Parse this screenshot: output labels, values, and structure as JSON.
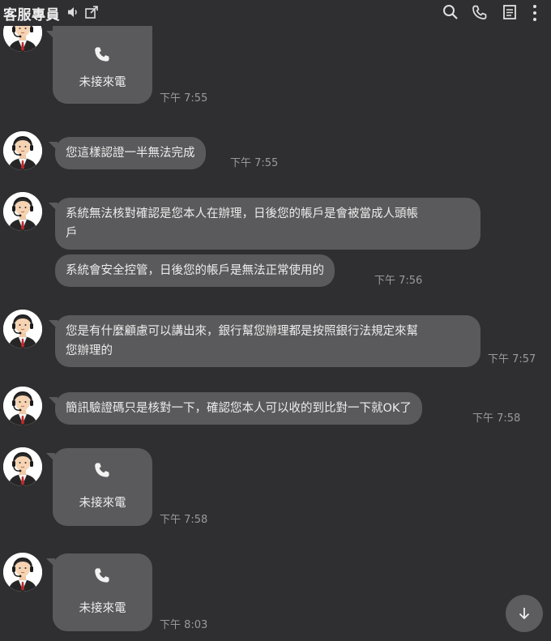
{
  "header": {
    "title": "客服專員",
    "icons": [
      "speaker-muted-icon",
      "external-link-icon",
      "search-icon",
      "phone-icon",
      "notes-icon",
      "more-icon"
    ]
  },
  "messages": [
    {
      "type": "missed_call",
      "label": "未接來電",
      "time": "下午 7:55"
    },
    {
      "type": "text",
      "lines": [
        "您這樣認證一半無法完成"
      ],
      "time": "下午 7:55"
    },
    {
      "type": "text",
      "lines": [
        "系統無法核對確認是您本人在辦理，日後您的帳戶是會被當成人頭帳",
        "戶"
      ]
    },
    {
      "type": "text",
      "lines": [
        "系統會安全控管，日後您的帳戶是無法正常使用的"
      ],
      "time": "下午 7:56"
    },
    {
      "type": "text",
      "lines": [
        "您是有什麼顧慮可以講出來，銀行幫您辦理都是按照銀行法規定來幫",
        "您辦理的"
      ],
      "time": "下午 7:57"
    },
    {
      "type": "text",
      "lines": [
        "簡訊驗證碼只是核對一下，確認您本人可以收的到比對一下就OK了"
      ],
      "time": "下午 7:58"
    },
    {
      "type": "missed_call",
      "label": "未接來電",
      "time": "下午 7:58"
    },
    {
      "type": "missed_call",
      "label": "未接來電",
      "time": "下午 8:03"
    }
  ],
  "scroll_button": {
    "icon": "arrow-down-icon"
  },
  "colors": {
    "background": "#2f2f31",
    "bubble": "#5a5a5c",
    "time": "#9a9a9a"
  }
}
